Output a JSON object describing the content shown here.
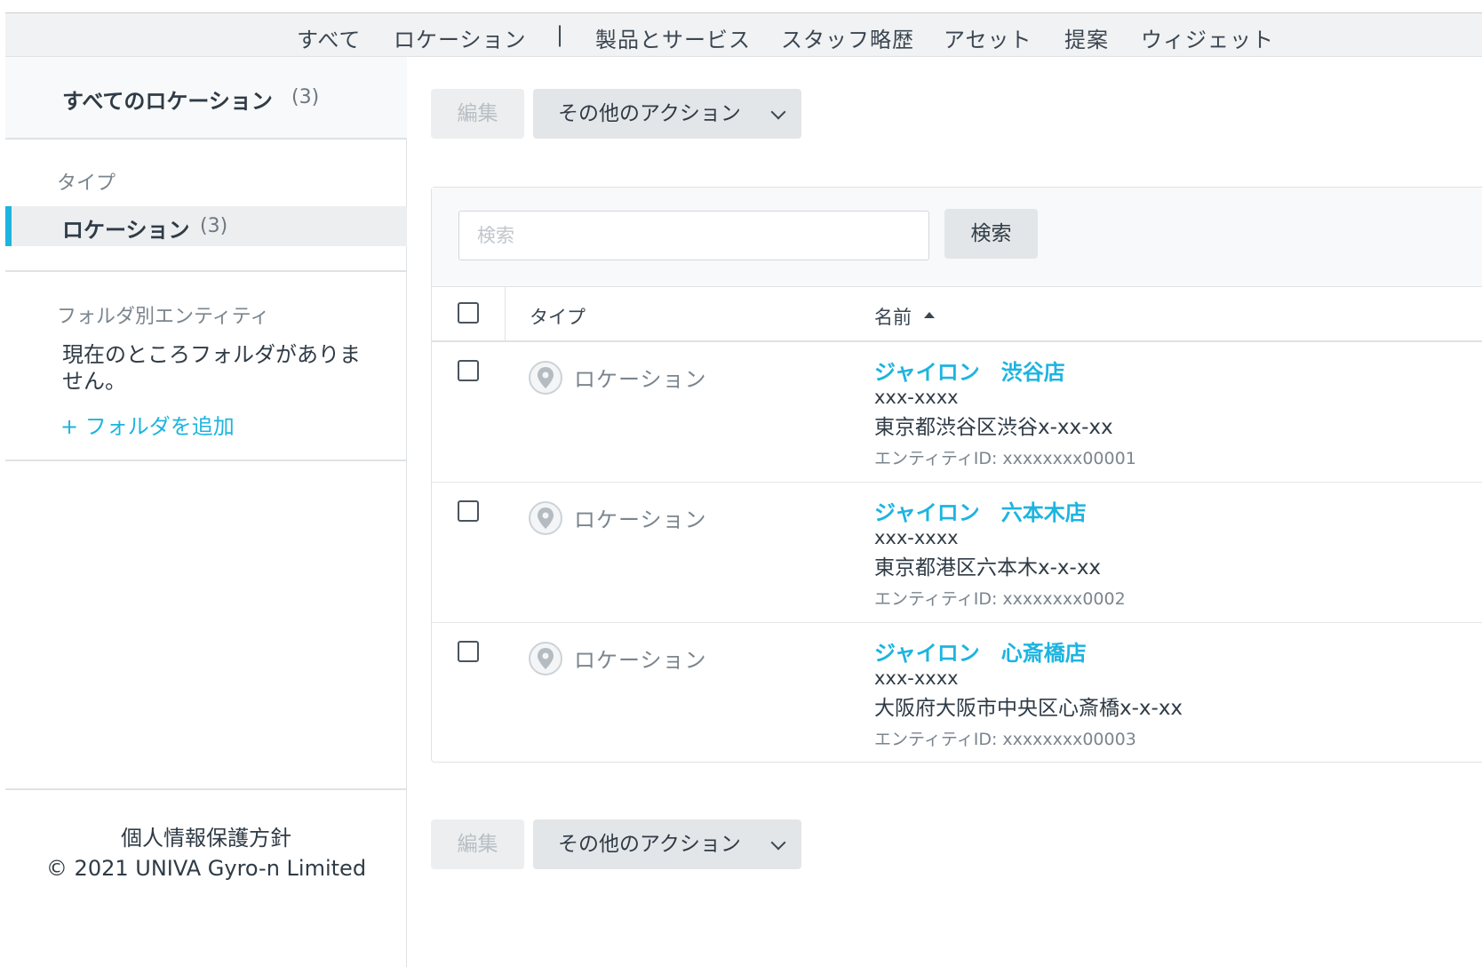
{
  "topnav": {
    "items": [
      "すべて",
      "ロケーション",
      "|",
      "製品とサービス",
      "スタッフ略歴",
      "アセット",
      "提案",
      "ウィジェット"
    ]
  },
  "sidebar": {
    "all_label": "すべてのロケーション",
    "all_count": "(3)",
    "type_heading": "タイプ",
    "type_item_label": "ロケーション",
    "type_item_count": "(3)",
    "folder_heading": "フォルダ別エンティティ",
    "no_folder_text": "現在のところフォルダがありません。",
    "add_folder_label": "+ フォルダを追加",
    "footer_privacy": "個人情報保護方針",
    "footer_copyright": "© 2021 UNIVA Gyro-n Limited"
  },
  "toolbar": {
    "edit_label": "編集",
    "more_actions_label": "その他のアクション"
  },
  "search": {
    "placeholder": "検索",
    "button_label": "検索"
  },
  "table": {
    "columns": {
      "type": "タイプ",
      "name": "名前"
    },
    "rows": [
      {
        "type": "ロケーション",
        "name": "ジャイロン　渋谷店",
        "zip": "xxx-xxxx",
        "address": "東京都渋谷区渋谷x-xx-xx",
        "entity_id": "エンティティID: xxxxxxxx00001"
      },
      {
        "type": "ロケーション",
        "name": "ジャイロン　六本木店",
        "zip": "xxx-xxxx",
        "address": "東京都港区六本木x-x-xx",
        "entity_id": "エンティティID: xxxxxxxx0002"
      },
      {
        "type": "ロケーション",
        "name": "ジャイロン　心斎橋店",
        "zip": "xxx-xxxx",
        "address": "大阪府大阪市中央区心斎橋x-x-xx",
        "entity_id": "エンティティID: xxxxxxxx00003"
      }
    ]
  },
  "colors": {
    "accent": "#1db4e0",
    "text": "#2f3b46",
    "muted": "#7b858e"
  }
}
